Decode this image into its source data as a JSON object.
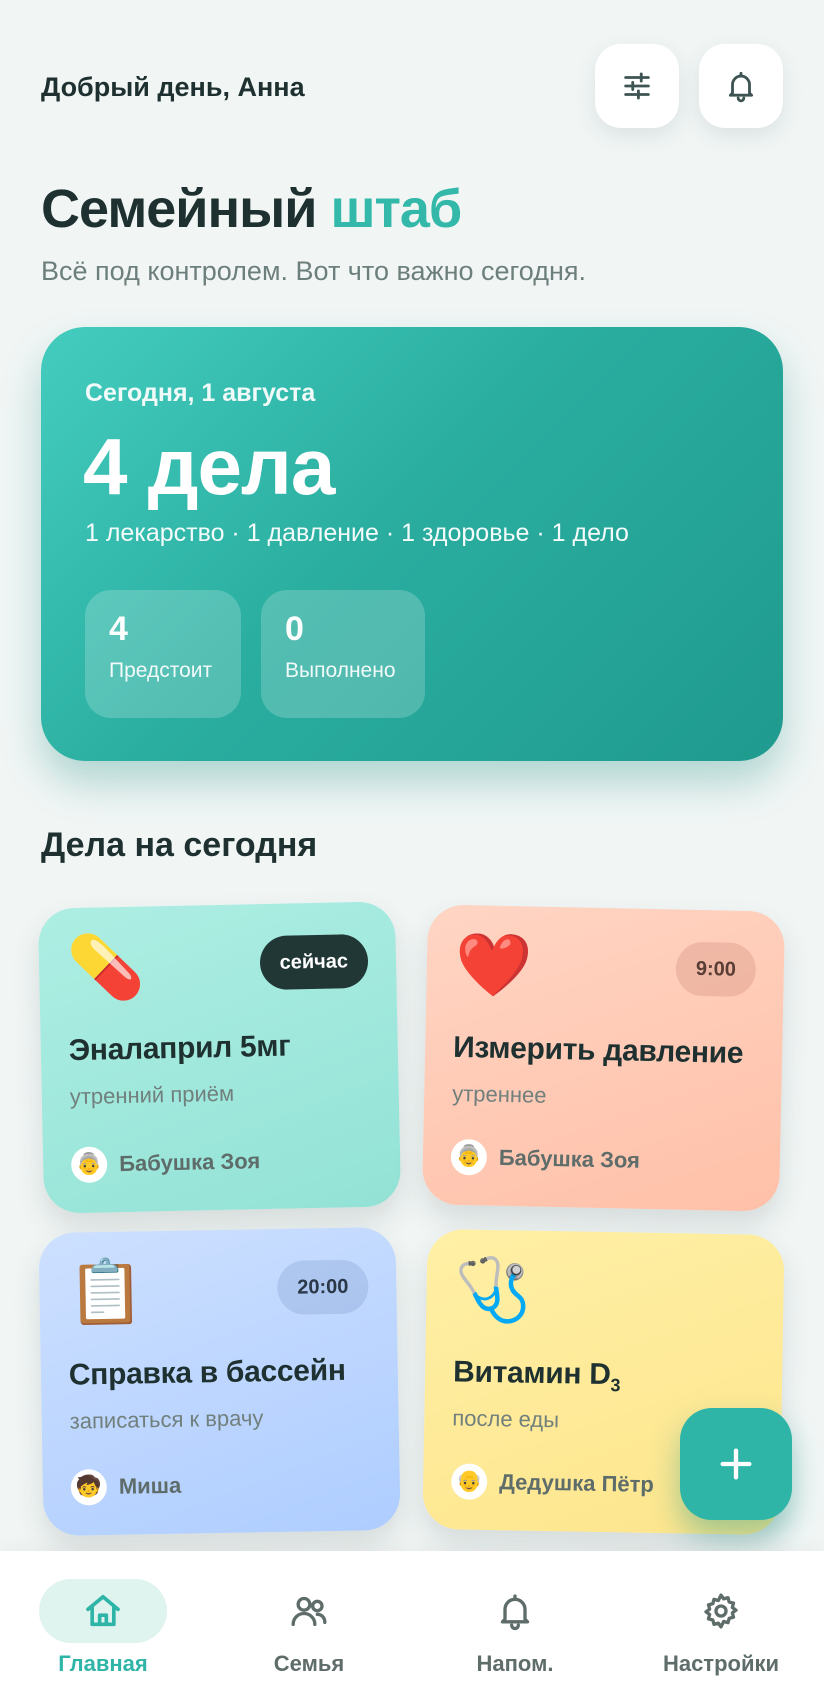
{
  "header": {
    "greeting": "Добрый день, Анна",
    "filters_icon": "sliders-icon",
    "bell_icon": "bell-icon"
  },
  "page": {
    "title_main": "Семейный",
    "title_accent": "штаб",
    "subtitle": "Всё под контролем. Вот что важно сегодня."
  },
  "summary": {
    "date": "Сегодня, 1 августа",
    "count": "4 дела",
    "breakdown": "1 лекарство · 1 давление · 1 здоровье · 1 дело",
    "stats": [
      {
        "value": "4",
        "label": "Предстоит"
      },
      {
        "value": "0",
        "label": "Выполнено"
      }
    ]
  },
  "tasks_section": {
    "title": "Дела на сегодня",
    "tasks": [
      {
        "emoji": "💊",
        "icon": "pill-icon",
        "badge": "сейчас",
        "title": "Эналаприл 5мг",
        "subtitle": "утренний приём",
        "avatar": "👵",
        "member": "Бабушка Зоя"
      },
      {
        "emoji": "❤️",
        "icon": "heart-icon",
        "badge": "9:00",
        "title": "Измерить давление",
        "subtitle": "утреннее",
        "avatar": "👵",
        "member": "Бабушка Зоя"
      },
      {
        "emoji": "📋",
        "icon": "clipboard-icon",
        "badge": "20:00",
        "title": "Справка в бассейн",
        "subtitle": "записаться к врачу",
        "avatar": "🧒",
        "member": "Миша"
      },
      {
        "emoji": "🩺",
        "icon": "stethoscope-icon",
        "title": "Витамин D",
        "title_sub": "3",
        "subtitle": "после еды",
        "avatar": "👴",
        "member": "Дедушка Пётр"
      }
    ]
  },
  "fab": {
    "icon": "plus-icon"
  },
  "colors": {
    "accent": "#33b8a9",
    "background": "#f1f6f5",
    "text_dark": "#1e3130"
  },
  "bottom_nav": {
    "items": [
      {
        "label": "Главная",
        "icon": "home-icon",
        "active": true
      },
      {
        "label": "Семья",
        "icon": "family-icon",
        "active": false
      },
      {
        "label": "Напом.",
        "icon": "bell-icon",
        "active": false
      },
      {
        "label": "Настройки",
        "icon": "gear-icon",
        "active": false
      }
    ]
  }
}
